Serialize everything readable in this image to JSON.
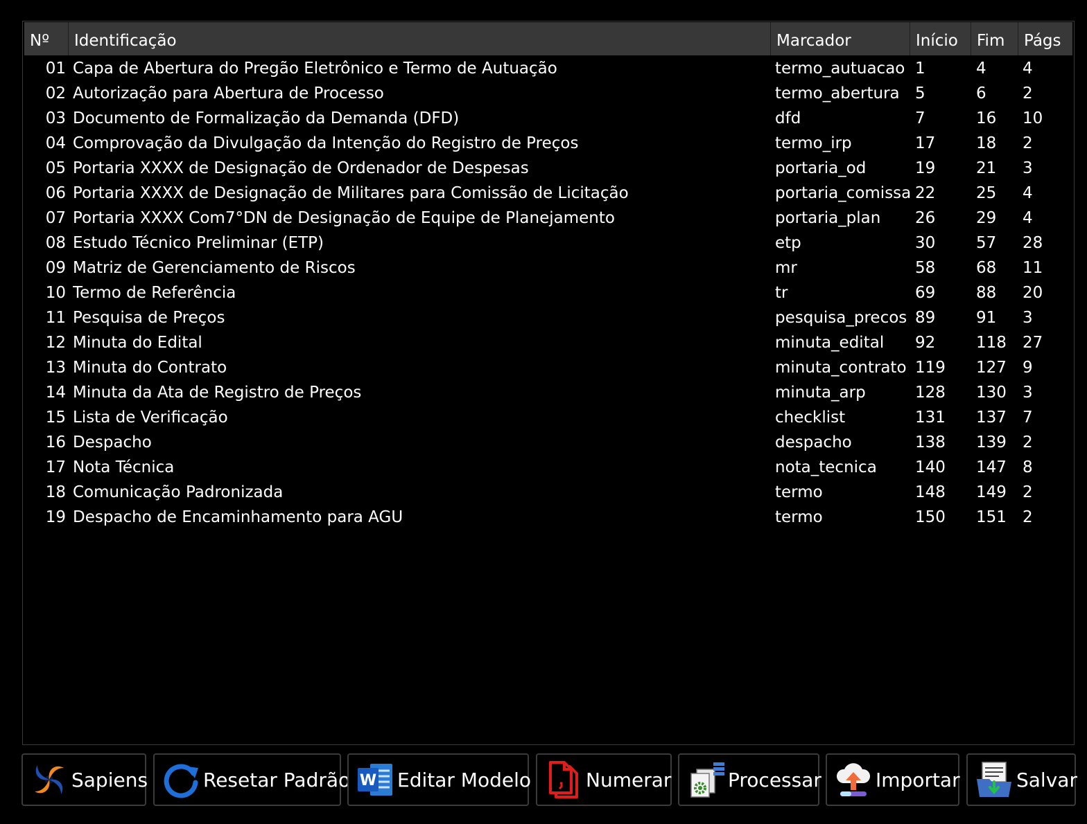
{
  "table": {
    "headers": {
      "num": "Nº",
      "identificacao": "Identificação",
      "marcador": "Marcador",
      "inicio": "Início",
      "fim": "Fim",
      "pags": "Págs"
    },
    "rows": [
      {
        "num": "01",
        "identificacao": "Capa de Abertura do Pregão Eletrônico e Termo de Autuação",
        "marcador": "termo_autuacao",
        "inicio": "1",
        "fim": "4",
        "pags": "4"
      },
      {
        "num": "02",
        "identificacao": "Autorização para Abertura de Processo",
        "marcador": "termo_abertura",
        "inicio": "5",
        "fim": "6",
        "pags": "2"
      },
      {
        "num": "03",
        "identificacao": "Documento de Formalização da Demanda (DFD)",
        "marcador": "dfd",
        "inicio": "7",
        "fim": "16",
        "pags": "10"
      },
      {
        "num": "04",
        "identificacao": "Comprovação da Divulgação da Intenção do Registro de Preços",
        "marcador": "termo_irp",
        "inicio": "17",
        "fim": "18",
        "pags": "2"
      },
      {
        "num": "05",
        "identificacao": "Portaria XXXX de Designação de Ordenador de Despesas",
        "marcador": "portaria_od",
        "inicio": "19",
        "fim": "21",
        "pags": "3"
      },
      {
        "num": "06",
        "identificacao": "Portaria XXXX de Designação de Militares para Comissão de Licitação",
        "marcador": "portaria_comissao",
        "inicio": "22",
        "fim": "25",
        "pags": "4"
      },
      {
        "num": "07",
        "identificacao": "Portaria XXXX Com7°DN de Designação de Equipe de Planejamento",
        "marcador": "portaria_plan",
        "inicio": "26",
        "fim": "29",
        "pags": "4"
      },
      {
        "num": "08",
        "identificacao": "Estudo Técnico Preliminar (ETP)",
        "marcador": "etp",
        "inicio": "30",
        "fim": "57",
        "pags": "28"
      },
      {
        "num": "09",
        "identificacao": "Matriz de Gerenciamento de Riscos",
        "marcador": "mr",
        "inicio": "58",
        "fim": "68",
        "pags": "11"
      },
      {
        "num": "10",
        "identificacao": "Termo de Referência",
        "marcador": "tr",
        "inicio": "69",
        "fim": "88",
        "pags": "20"
      },
      {
        "num": "11",
        "identificacao": "Pesquisa de Preços",
        "marcador": "pesquisa_precos",
        "inicio": "89",
        "fim": "91",
        "pags": "3"
      },
      {
        "num": "12",
        "identificacao": "Minuta do Edital",
        "marcador": "minuta_edital",
        "inicio": "92",
        "fim": "118",
        "pags": "27"
      },
      {
        "num": "13",
        "identificacao": "Minuta do Contrato",
        "marcador": "minuta_contrato",
        "inicio": "119",
        "fim": "127",
        "pags": "9"
      },
      {
        "num": "14",
        "identificacao": "Minuta da Ata de Registro de Preços",
        "marcador": "minuta_arp",
        "inicio": "128",
        "fim": "130",
        "pags": "3"
      },
      {
        "num": "15",
        "identificacao": "Lista de Verificação",
        "marcador": "checklist",
        "inicio": "131",
        "fim": "137",
        "pags": "7"
      },
      {
        "num": "16",
        "identificacao": "Despacho",
        "marcador": "despacho",
        "inicio": "138",
        "fim": "139",
        "pags": "2"
      },
      {
        "num": "17",
        "identificacao": "Nota Técnica",
        "marcador": "nota_tecnica",
        "inicio": "140",
        "fim": "147",
        "pags": "8"
      },
      {
        "num": "18",
        "identificacao": "Comunicação Padronizada",
        "marcador": "termo",
        "inicio": "148",
        "fim": "149",
        "pags": "2"
      },
      {
        "num": "19",
        "identificacao": "Despacho de Encaminhamento para AGU",
        "marcador": "termo",
        "inicio": "150",
        "fim": "151",
        "pags": "2"
      }
    ]
  },
  "toolbar": {
    "sapiens": {
      "label": "Sapiens",
      "icon": "sapiens-logo-icon"
    },
    "resetar": {
      "label": "Resetar Padrão",
      "icon": "refresh-icon"
    },
    "editar": {
      "label": "Editar Modelo",
      "icon": "word-icon"
    },
    "numerar": {
      "label": "Numerar",
      "icon": "pdf-document-icon"
    },
    "processar": {
      "label": "Processar",
      "icon": "process-settings-icon"
    },
    "importar": {
      "label": "Importar",
      "icon": "cloud-upload-icon"
    },
    "salvar": {
      "label": "Salvar",
      "icon": "save-folder-icon"
    }
  },
  "colors": {
    "background": "#000000",
    "header_bg": "#383838",
    "border": "#3b3b3b",
    "text": "#ffffff"
  }
}
